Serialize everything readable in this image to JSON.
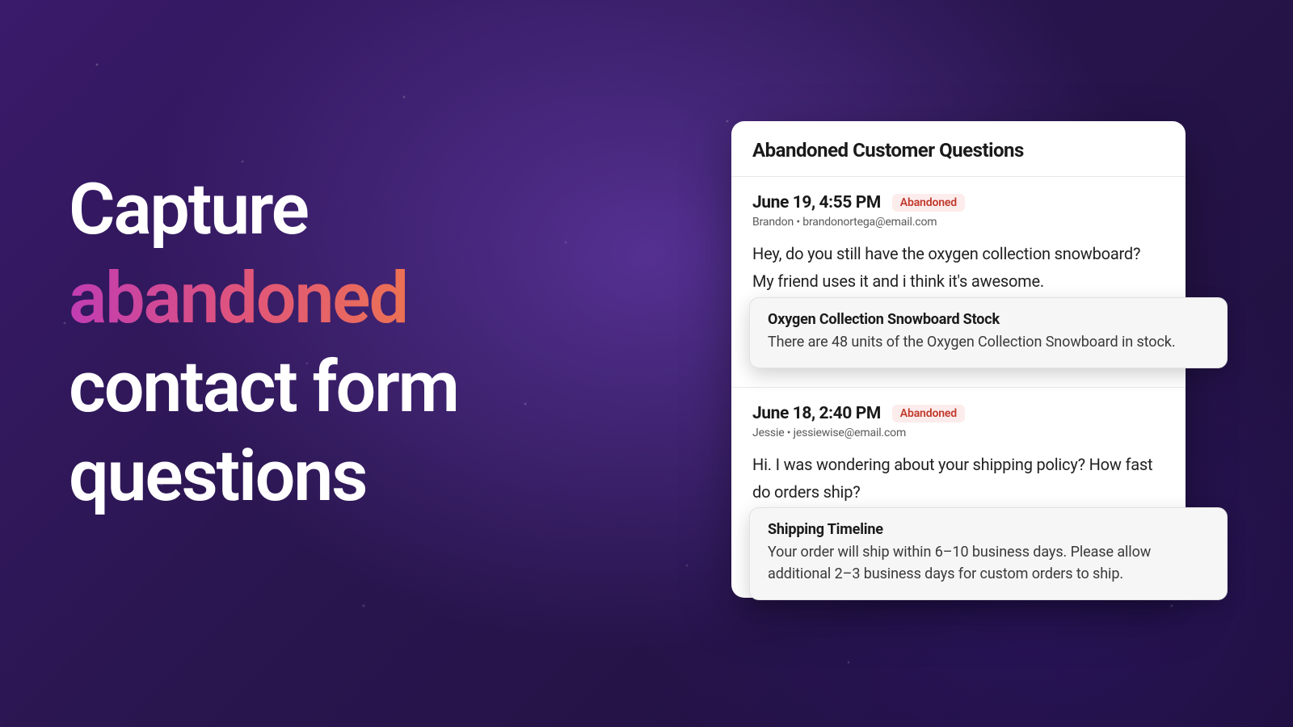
{
  "hero": {
    "line1": "Capture",
    "highlight": "abandoned",
    "line3": "contact form",
    "line4": "questions"
  },
  "panel": {
    "title": "Abandoned Customer Questions",
    "badge_label": "Abandoned",
    "questions": [
      {
        "timestamp": "June 19, 4:55 PM",
        "name": "Brandon",
        "email": "brandonortega@email.com",
        "body": "Hey, do you still have the oxygen collection snowboard? My friend uses it and i think it's awesome.",
        "answer": {
          "title": "Oxygen Collection Snowboard Stock",
          "body": "There are 48 units of the Oxygen Collection Snowboard in stock."
        }
      },
      {
        "timestamp": "June 18, 2:40 PM",
        "name": "Jessie",
        "email": "jessiewise@email.com",
        "body": "Hi. I was wondering about your shipping policy? How fast do orders ship?",
        "answer": {
          "title": "Shipping Timeline",
          "body": "Your order will ship within 6–10 business days. Please allow additional 2–3 business days for custom orders to ship."
        }
      }
    ]
  }
}
